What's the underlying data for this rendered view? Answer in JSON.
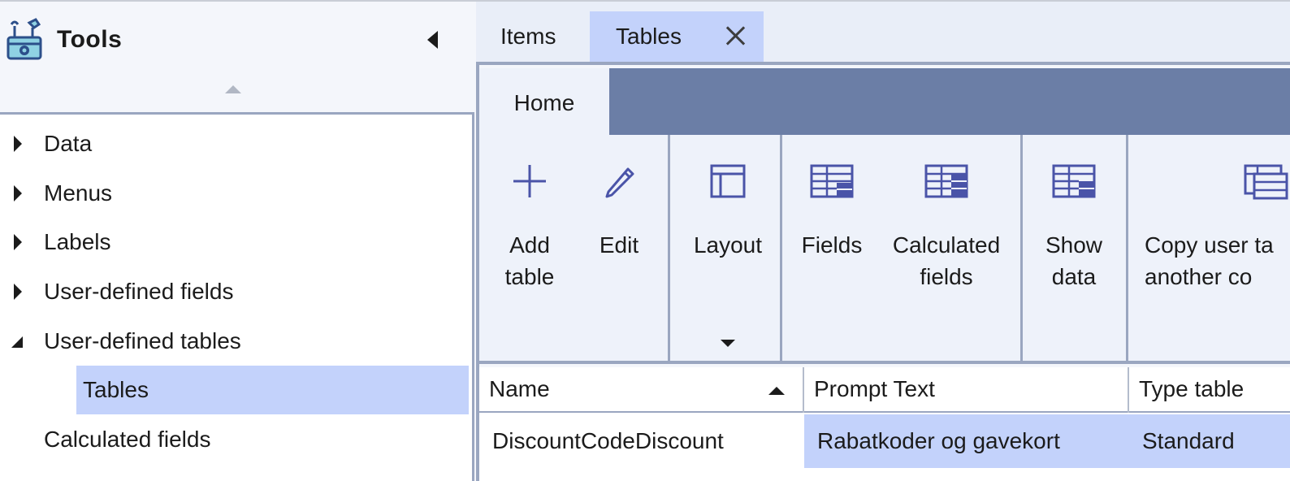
{
  "sidebar": {
    "title": "Tools",
    "tree": [
      {
        "label": "Data",
        "expanded": false
      },
      {
        "label": "Menus",
        "expanded": false
      },
      {
        "label": "Labels",
        "expanded": false
      },
      {
        "label": "User-defined fields",
        "expanded": false
      },
      {
        "label": "User-defined tables",
        "expanded": true
      },
      {
        "label": "Tables",
        "selected": true
      },
      {
        "label": "Calculated fields"
      }
    ]
  },
  "tabs": [
    {
      "label": "Items"
    },
    {
      "label": "Tables",
      "active": true
    }
  ],
  "ribbon": {
    "tab": "Home",
    "buttons": {
      "add_table": "Add table",
      "edit": "Edit",
      "layout": "Layout",
      "fields": "Fields",
      "calculated_fields": "Calculated fields",
      "show_data": "Show data",
      "copy_user_table": "Copy user ta another co"
    }
  },
  "grid": {
    "columns": [
      "Name",
      "Prompt Text",
      "Type table"
    ],
    "sort_column": "Name",
    "rows": [
      {
        "name": "DiscountCodeDiscount",
        "prompt_text": "Rabatkoder og gavekort",
        "type_table": "Standard"
      }
    ]
  },
  "colors": {
    "accent": "#c3d2fb",
    "ribbon_bar": "#6b7ea6",
    "border": "#9aa6c0",
    "icon": "#4a54a8"
  }
}
